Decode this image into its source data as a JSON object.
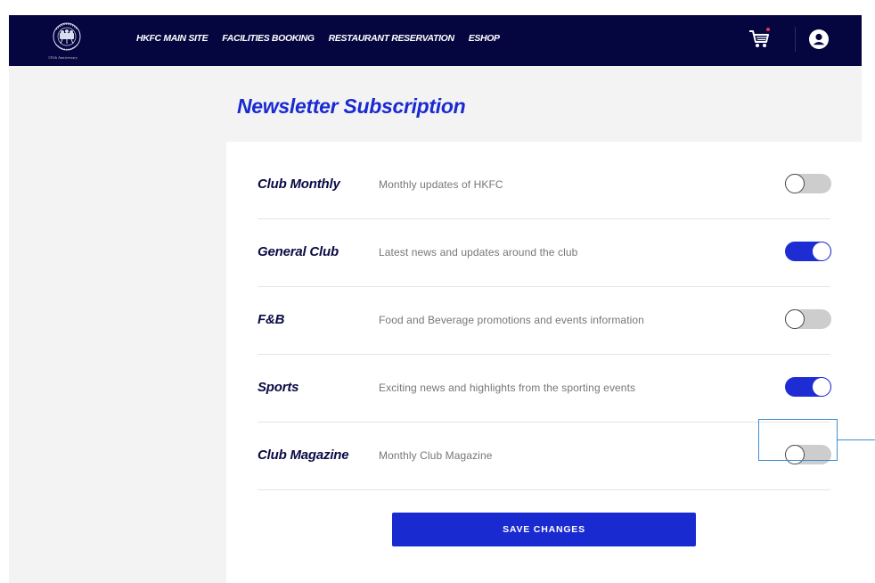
{
  "nav": {
    "items": [
      "HKFC MAIN SITE",
      "FACILITIES BOOKING",
      "RESTAURANT RESERVATION",
      "ESHOP"
    ]
  },
  "logo": {
    "subtitle": "135th Anniversary"
  },
  "page": {
    "title": "Newsletter Subscription"
  },
  "subscriptions": [
    {
      "title": "Club Monthly",
      "description": "Monthly updates of HKFC",
      "enabled": false
    },
    {
      "title": "General Club",
      "description": "Latest news and updates around the club",
      "enabled": true
    },
    {
      "title": "F&B",
      "description": "Food and Beverage promotions and events information",
      "enabled": false
    },
    {
      "title": "Sports",
      "description": "Exciting news and highlights from the sporting events",
      "enabled": true
    },
    {
      "title": "Club Magazine",
      "description": "Monthly Club Magazine",
      "enabled": false
    }
  ],
  "actions": {
    "save_label": "SAVE CHANGES"
  },
  "colors": {
    "header": "#05053f",
    "accent": "#1a2ad1",
    "toggle_off": "#cdcdcd",
    "notification": "#e8344f"
  }
}
